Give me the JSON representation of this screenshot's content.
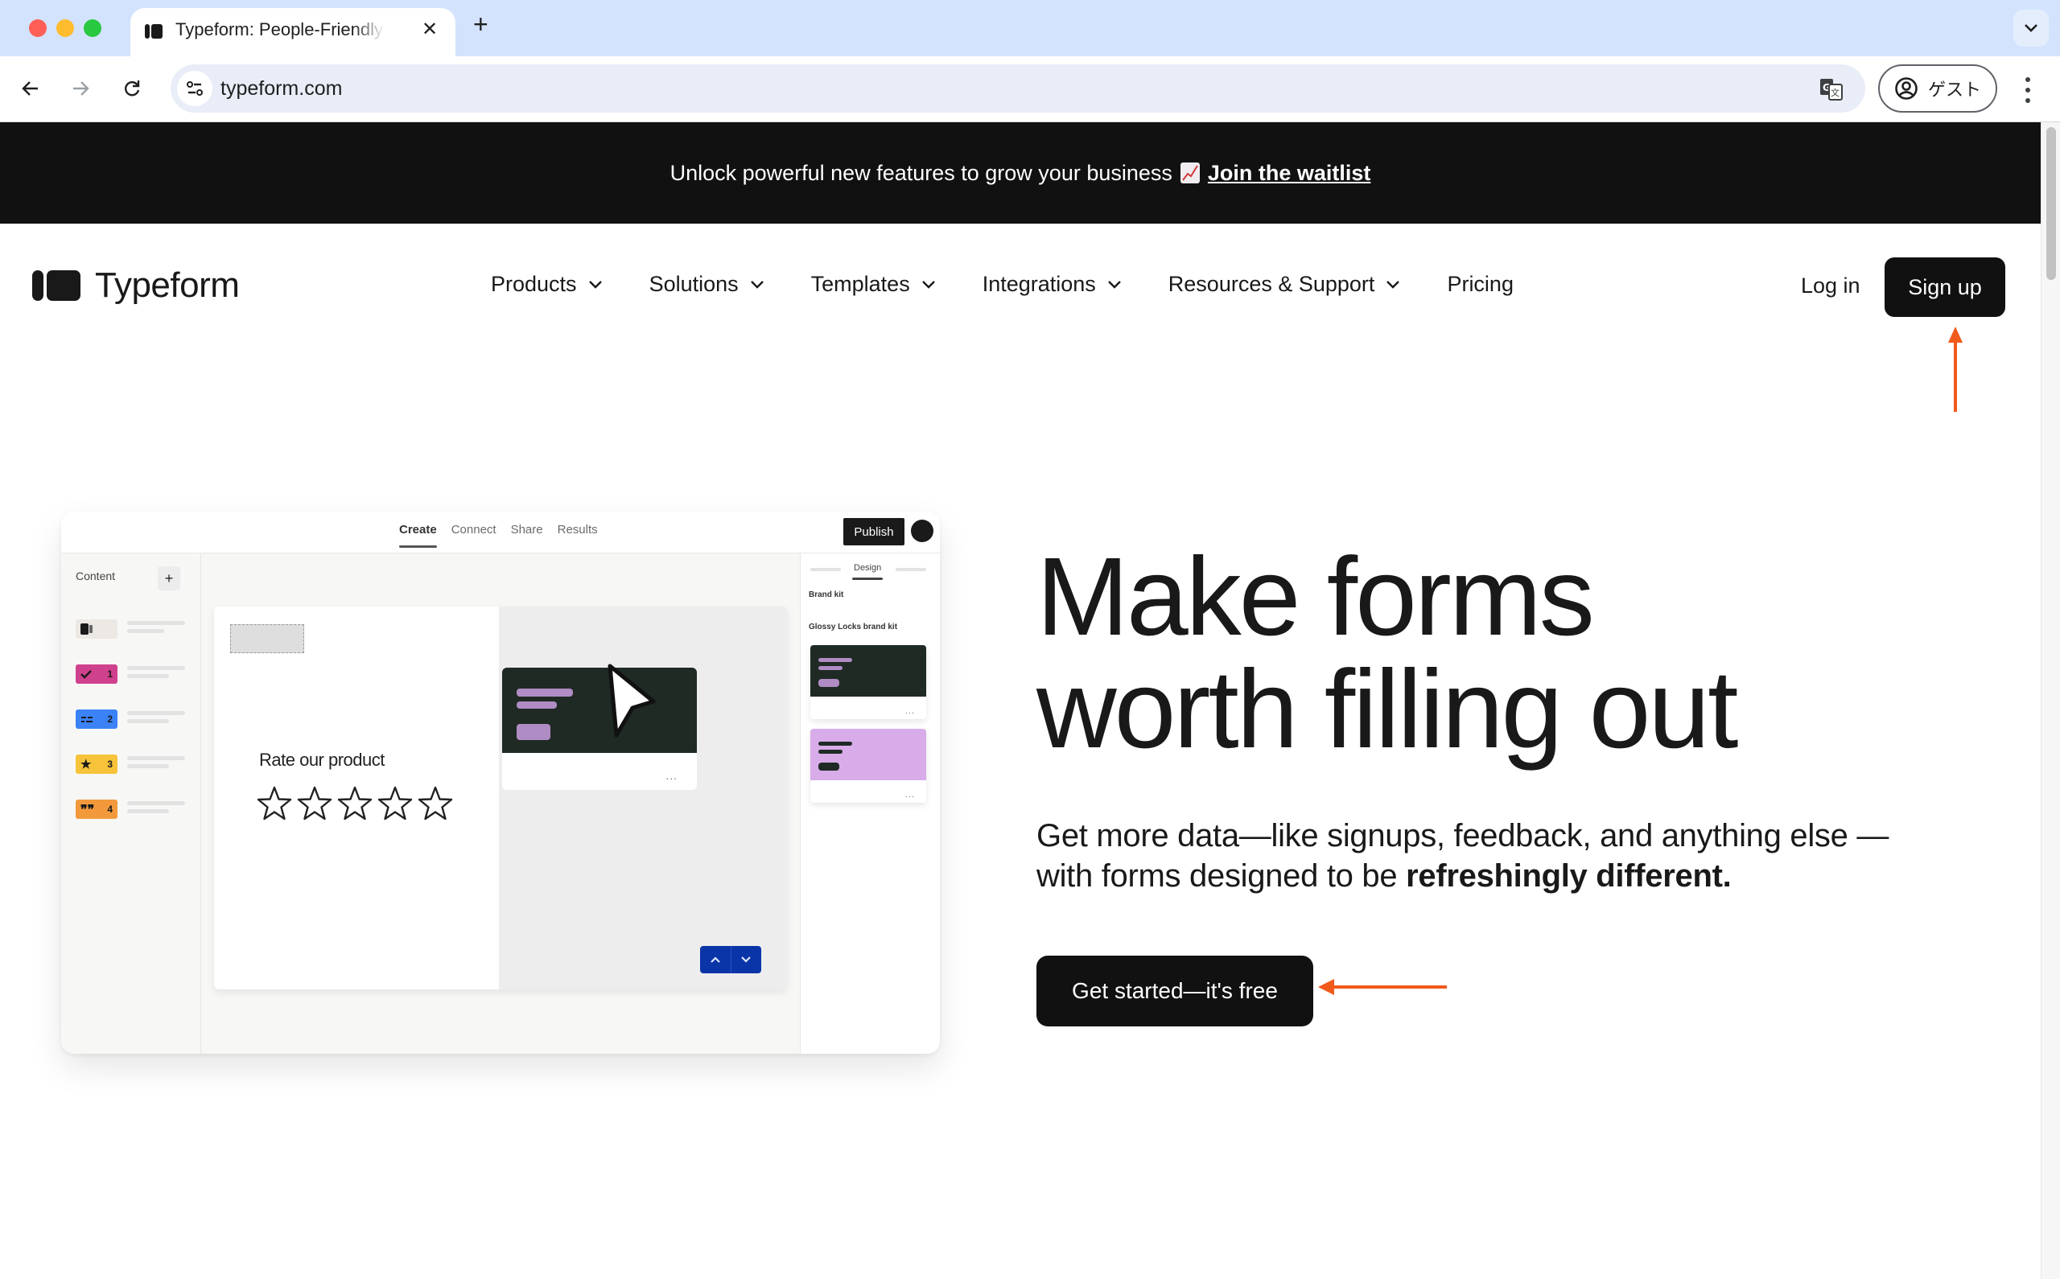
{
  "browser": {
    "tab_title": "Typeform: People-Friendly Forms and Surveys",
    "url": "typeform.com",
    "profile_label": "ゲスト",
    "icons": [
      "back-arrow-icon",
      "forward-arrow-icon",
      "reload-icon",
      "site-info-icon",
      "translate-icon",
      "profile-icon",
      "more-menu-icon",
      "tab-search-icon",
      "new-tab-icon",
      "close-tab-icon"
    ]
  },
  "banner": {
    "text": "Unlock powerful new features to grow your business",
    "emoji": "chart-increasing-icon",
    "link": "Join the waitlist"
  },
  "header": {
    "logo_text": "Typeform",
    "nav": [
      {
        "label": "Products",
        "has_dropdown": true
      },
      {
        "label": "Solutions",
        "has_dropdown": true
      },
      {
        "label": "Templates",
        "has_dropdown": true
      },
      {
        "label": "Integrations",
        "has_dropdown": true
      },
      {
        "label": "Resources & Support",
        "has_dropdown": true
      },
      {
        "label": "Pricing",
        "has_dropdown": false
      }
    ],
    "login": "Log in",
    "signup": "Sign up"
  },
  "mockup": {
    "tabs": [
      "Create",
      "Connect",
      "Share",
      "Results"
    ],
    "active_tab": "Create",
    "publish": "Publish",
    "content_label": "Content",
    "add": "+",
    "questions": [
      {
        "number": "",
        "icon": "welcome-icon",
        "color": "#ece8e3"
      },
      {
        "number": "1",
        "icon": "check-icon",
        "color": "#d0418d"
      },
      {
        "number": "2",
        "icon": "short-text-icon",
        "color": "#3b82f6"
      },
      {
        "number": "3",
        "icon": "star-icon",
        "color": "#f6c33a"
      },
      {
        "number": "4",
        "icon": "quote-icon",
        "color": "#f29a3b"
      }
    ],
    "question_text": "Rate our product",
    "rating_max": 5,
    "rating_value": 0,
    "panel_tab": "Design",
    "brand_kit_label": "Brand kit",
    "brand_kit_name": "Glossy Locks brand kit",
    "more": "...",
    "themes": [
      {
        "bg": "#1f2a24",
        "accent": "#b08cc4"
      },
      {
        "bg": "#d8ace8",
        "accent": "#1f2a24"
      }
    ]
  },
  "hero": {
    "title_line1": "Make forms",
    "title_line2": "worth filling out",
    "subtitle_plain": "Get more data—like signups, feedback, and anything else —with forms designed to be ",
    "subtitle_bold": "refreshingly different.",
    "cta": "Get started—it's free"
  },
  "annotations": {
    "color": "#f05a1a",
    "targets": [
      "signup-button",
      "get-started-button"
    ]
  }
}
